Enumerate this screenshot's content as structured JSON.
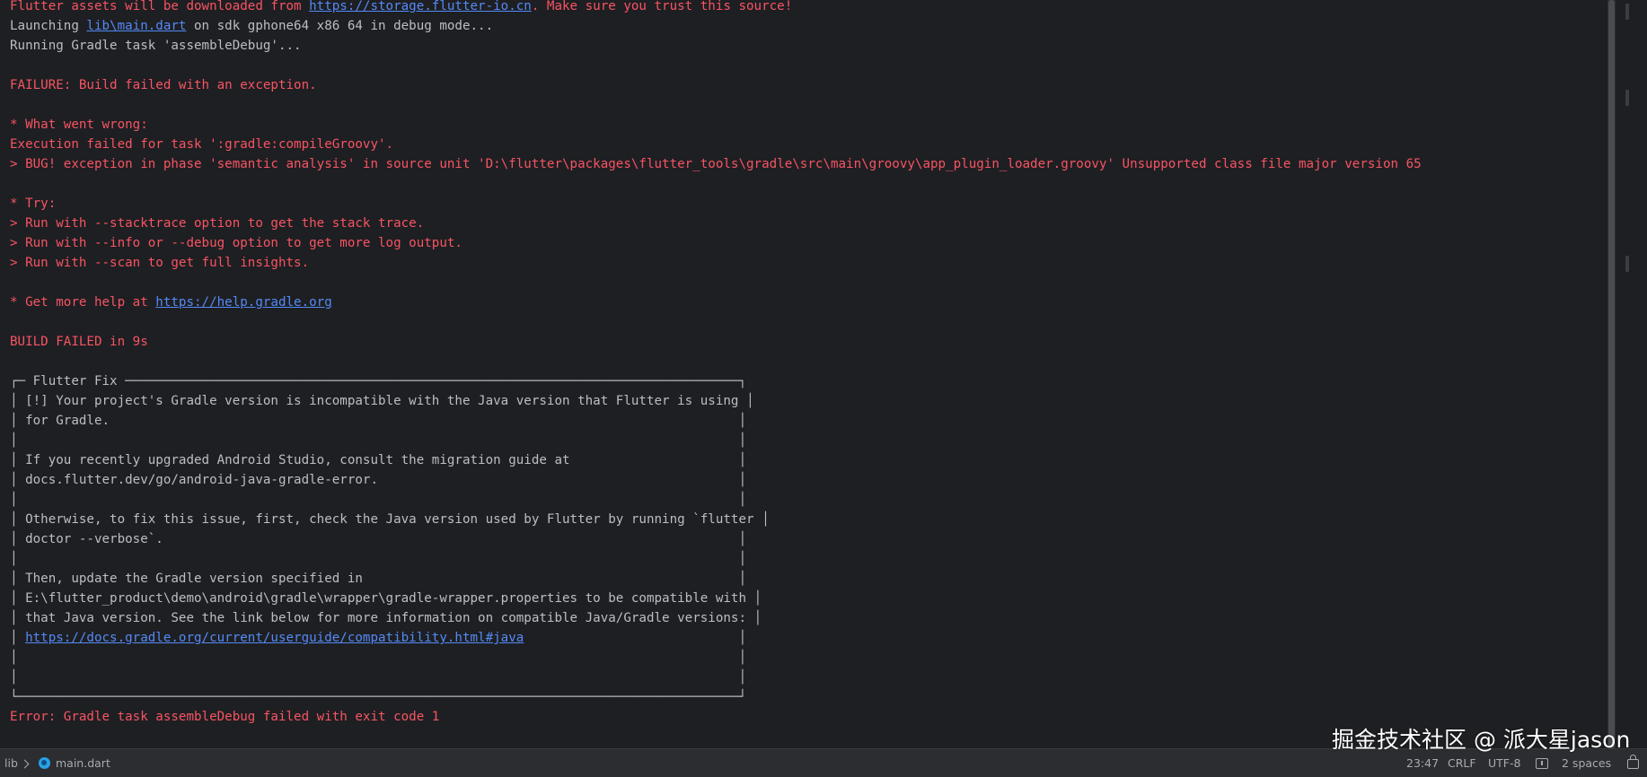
{
  "console": {
    "lines": [
      [
        {
          "t": "Flutter assets will be downloaded from ",
          "c": "e"
        },
        {
          "t": "https://storage.flutter-io.cn",
          "c": "lk",
          "link": true
        },
        {
          "t": ". Make sure you trust this source!",
          "c": "e"
        }
      ],
      [
        {
          "t": "Launching ",
          "c": "w"
        },
        {
          "t": "lib\\main.dart",
          "c": "lk",
          "link": true
        },
        {
          "t": " on sdk gphone64 x86 64 in debug mode...",
          "c": "w"
        }
      ],
      [
        {
          "t": "Running Gradle task 'assembleDebug'...",
          "c": "w"
        }
      ],
      [],
      [
        {
          "t": "FAILURE: Build failed with an exception.",
          "c": "e"
        }
      ],
      [],
      [
        {
          "t": "* What went wrong:",
          "c": "e"
        }
      ],
      [
        {
          "t": "Execution failed for task ':gradle:compileGroovy'.",
          "c": "e"
        }
      ],
      [
        {
          "t": "> BUG! exception in phase 'semantic analysis' in source unit 'D:\\flutter\\packages\\flutter_tools\\gradle\\src\\main\\groovy\\app_plugin_loader.groovy' Unsupported class file major version 65",
          "c": "e"
        }
      ],
      [],
      [
        {
          "t": "* Try:",
          "c": "e"
        }
      ],
      [
        {
          "t": "> Run with --stacktrace option to get the stack trace.",
          "c": "e"
        }
      ],
      [
        {
          "t": "> Run with --info or --debug option to get more log output.",
          "c": "e"
        }
      ],
      [
        {
          "t": "> Run with --scan to get full insights.",
          "c": "e"
        }
      ],
      [],
      [
        {
          "t": "* Get more help at ",
          "c": "e"
        },
        {
          "t": "https://help.gradle.org",
          "c": "lk",
          "link": true
        }
      ],
      [],
      [
        {
          "t": "BUILD FAILED in 9s",
          "c": "e"
        }
      ],
      [],
      [
        {
          "t": "┌─ Flutter Fix ────────────────────────────────────────────────────────────────────────────────┐",
          "c": "box"
        }
      ],
      [
        {
          "t": "│ [!] Your project's Gradle version is incompatible with the Java version that Flutter is using │",
          "c": "box"
        }
      ],
      [
        {
          "t": "│ for Gradle.                                                                                  │",
          "c": "box"
        }
      ],
      [
        {
          "t": "│                                                                                              │",
          "c": "box"
        }
      ],
      [
        {
          "t": "│ If you recently upgraded Android Studio, consult the migration guide at                      │",
          "c": "box"
        }
      ],
      [
        {
          "t": "│ docs.flutter.dev/go/android-java-gradle-error.                                               │",
          "c": "box"
        }
      ],
      [
        {
          "t": "│                                                                                              │",
          "c": "box"
        }
      ],
      [
        {
          "t": "│ Otherwise, to fix this issue, first, check the Java version used by Flutter by running `flutter │",
          "c": "box"
        }
      ],
      [
        {
          "t": "│ doctor --verbose`.                                                                           │",
          "c": "box"
        }
      ],
      [
        {
          "t": "│                                                                                              │",
          "c": "box"
        }
      ],
      [
        {
          "t": "│ Then, update the Gradle version specified in                                                 │",
          "c": "box"
        }
      ],
      [
        {
          "t": "│ E:\\flutter_product\\demo\\android\\gradle\\wrapper\\gradle-wrapper.properties to be compatible with │",
          "c": "box"
        }
      ],
      [
        {
          "t": "│ that Java version. See the link below for more information on compatible Java/Gradle versions: │",
          "c": "box"
        }
      ],
      [
        {
          "t": "│ ",
          "c": "box"
        },
        {
          "t": "https://docs.gradle.org/current/userguide/compatibility.html#java",
          "c": "lk",
          "link": true
        },
        {
          "t": "                            │",
          "c": "box"
        }
      ],
      [
        {
          "t": "│                                                                                              │",
          "c": "box"
        }
      ],
      [
        {
          "t": "│                                                                                              │",
          "c": "box"
        }
      ],
      [
        {
          "t": "└──────────────────────────────────────────────────────────────────────────────────────────────┘",
          "c": "box"
        }
      ],
      [
        {
          "t": "Error: Gradle task assembleDebug failed with exit code 1",
          "c": "e"
        }
      ]
    ]
  },
  "statusbar": {
    "breadcrumb_root": "lib",
    "breadcrumb_file": "main.dart",
    "cursor_position": "23:47",
    "line_separator": "CRLF",
    "encoding": "UTF-8",
    "indent": "2 spaces"
  },
  "watermark": "掘金技术社区 @ 派大星jason",
  "colors": {
    "background": "#1e1f22",
    "error_text": "#f75464",
    "normal_text": "#bcbec4",
    "link": "#548af7",
    "statusbar_bg": "#2b2d30"
  },
  "icons": [
    "chevron-right-icon",
    "dart-file-icon",
    "message-icon",
    "lock-icon"
  ]
}
